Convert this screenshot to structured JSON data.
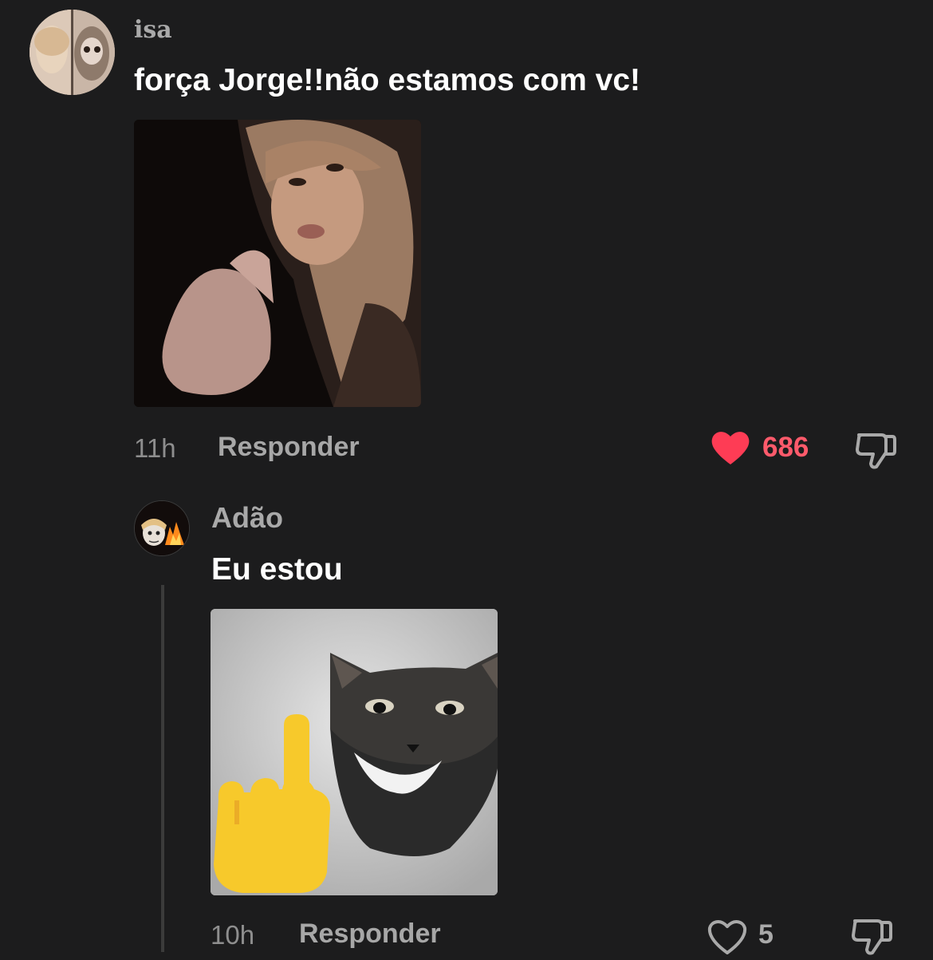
{
  "comments": [
    {
      "username": "isa",
      "text": "força Jorge!!não estamos com vc!",
      "time": "11h",
      "reply_label": "Responder",
      "likes": "686",
      "liked": true,
      "media": "gif"
    },
    {
      "username": "Adão",
      "text": "Eu estou",
      "time": "10h",
      "reply_label": "Responder",
      "likes": "5",
      "liked": false,
      "media": "gif"
    }
  ],
  "icons": {
    "like_active": "heart-filled-icon",
    "like_inactive": "heart-outline-icon",
    "dislike": "thumbs-down-icon"
  },
  "colors": {
    "background": "#1c1c1d",
    "like_active": "#fe3c55",
    "secondary_text": "#a9a9a9"
  }
}
